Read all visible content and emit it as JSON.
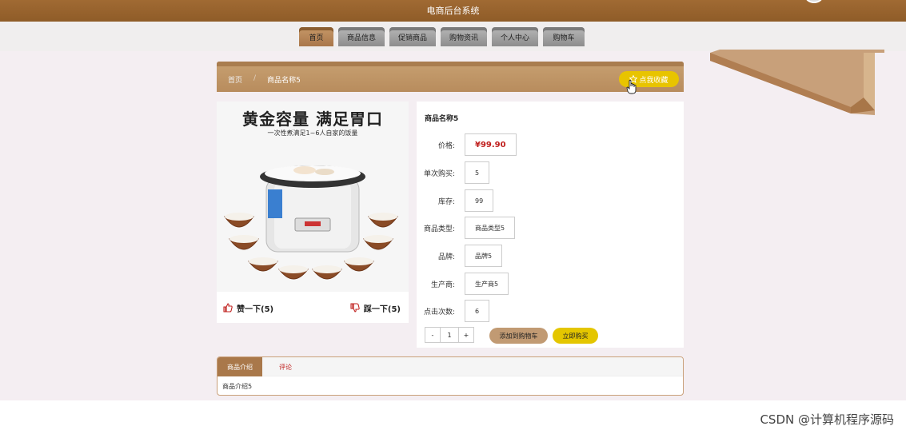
{
  "header": {
    "title": "电商后台系统"
  },
  "nav": {
    "items": [
      "首页",
      "商品信息",
      "促销商品",
      "购物资讯",
      "个人中心",
      "购物车"
    ]
  },
  "breadcrumb": {
    "home": "首页",
    "separator": "/",
    "current": "商品名称5"
  },
  "favorite_button": "点我收藏",
  "product_image": {
    "headline": "黄金容量 满足胃口",
    "subline": "一次性煮满足1~6人自家的饭量"
  },
  "votes": {
    "like": "赞一下(5)",
    "dislike": "踩一下(5)"
  },
  "product": {
    "name": "商品名称5",
    "fields": [
      {
        "label": "价格:",
        "value": "¥99.90"
      },
      {
        "label": "单次购买:",
        "value": "5"
      },
      {
        "label": "库存:",
        "value": "99"
      },
      {
        "label": "商品类型:",
        "value": "商品类型5"
      },
      {
        "label": "品牌:",
        "value": "品牌5"
      },
      {
        "label": "生产商:",
        "value": "生产商5"
      },
      {
        "label": "点击次数:",
        "value": "6"
      }
    ]
  },
  "quantity": {
    "minus": "-",
    "value": "1",
    "plus": "+"
  },
  "actions": {
    "add_to_cart": "添加到购物车",
    "buy_now": "立即购买"
  },
  "tabs": {
    "items": [
      "商品介绍",
      "评论"
    ],
    "content": "商品介绍5"
  },
  "watermark": "CSDN @计算机程序源码",
  "colors": {
    "header": "#9a6530",
    "accent_yellow": "#e4c600",
    "price_red": "#c0201e",
    "tab_active": "#a9784a"
  }
}
